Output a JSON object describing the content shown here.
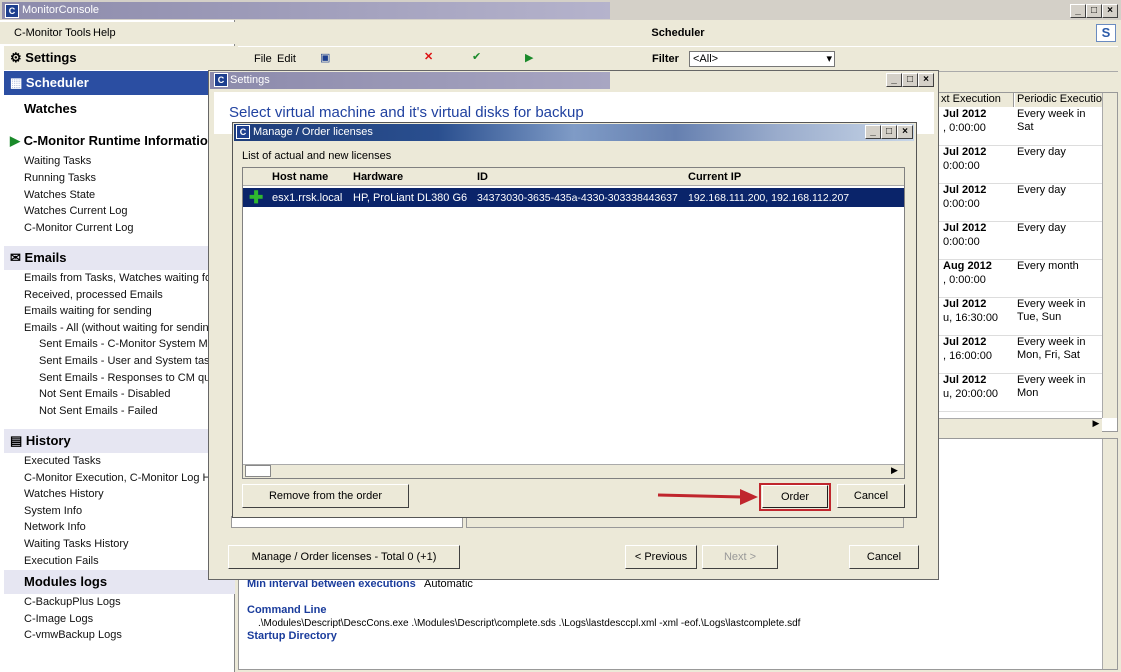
{
  "window": {
    "title": "MonitorConsole",
    "logo": "C"
  },
  "menu": {
    "tools": "C-Monitor Tools",
    "help": "Help"
  },
  "sidebar": {
    "settings": "Settings",
    "scheduler": "Scheduler",
    "watches": "Watches",
    "runtime": "C-Monitor Runtime Informatio",
    "runtime_items": [
      "Waiting Tasks",
      "Running Tasks",
      "Watches State",
      "Watches Current Log",
      "C-Monitor Current Log"
    ],
    "emails": "Emails",
    "email_items": [
      "Emails from Tasks, Watches waiting for se",
      "Received, processed Emails",
      "Emails waiting for sending",
      "Emails - All (without waiting for sending)"
    ],
    "email_sub_items": [
      "Sent Emails - C-Monitor System Messa",
      "Sent Emails - User and System tasks R",
      "Sent Emails - Responses to CM querie",
      "Not Sent Emails - Disabled",
      "Not Sent Emails - Failed"
    ],
    "history": "History",
    "history_items": [
      "Executed Tasks",
      "C-Monitor Execution, C-Monitor Log Histor",
      "Watches History",
      "System Info",
      "Network Info",
      "Waiting Tasks History",
      "Execution Fails"
    ],
    "modules": "Modules logs",
    "module_items": [
      "C-BackupPlus Logs",
      "C-Image Logs",
      "C-vmwBackup Logs"
    ]
  },
  "scheduler": {
    "title": "Scheduler",
    "toolbar": {
      "file": "File",
      "edit": "Edit",
      "filter": "Filter",
      "filter_value": "<All>"
    },
    "columns": {
      "next": "xt Execution",
      "periodic": "Periodic Execution"
    },
    "rows": [
      {
        "date": "Jul 2012",
        "time": ", 0:00:00",
        "period": "Every week in Sat"
      },
      {
        "date": "Jul 2012",
        "time": "0:00:00",
        "period": "Every day"
      },
      {
        "date": "Jul 2012",
        "time": "0:00:00",
        "period": "Every day"
      },
      {
        "date": "Jul 2012",
        "time": "0:00:00",
        "period": "Every day"
      },
      {
        "date": "Aug 2012",
        "time": ", 0:00:00",
        "period": "Every month"
      },
      {
        "date": "Jul 2012",
        "time": "u, 16:30:00",
        "period": "Every week in Tue, Sun"
      },
      {
        "date": "Jul 2012",
        "time": ", 16:00:00",
        "period": "Every week in Mon, Fri, Sat"
      },
      {
        "date": "Jul 2012",
        "time": "u, 20:00:00",
        "period": "Every week in Mon"
      }
    ],
    "details": {
      "min_interval_label": "Min interval between executions",
      "min_interval_value": "Automatic",
      "command_line_label": "Command Line",
      "command_line_value": ".\\Modules\\Descript\\DescCons.exe .\\Modules\\Descript\\complete.sds .\\Logs\\lastdesccpl.xml -xml -eof.\\Logs\\lastcomplete.sdf",
      "startup_label": "Startup Directory"
    }
  },
  "settings_dialog": {
    "title": "Settings",
    "heading": "Select virtual machine and it's virtual disks for backup",
    "licenses_button": "Manage / Order licenses - Total 0 (+1)",
    "previous": "< Previous",
    "next": "Next >",
    "cancel": "Cancel"
  },
  "licenses_dialog": {
    "title": "Manage / Order licenses",
    "list_label": "List of actual and new licenses",
    "columns": {
      "host": "Host name",
      "hardware": "Hardware",
      "id": "ID",
      "ip": "Current IP"
    },
    "rows": [
      {
        "host": "esx1.rrsk.local",
        "hardware": "HP, ProLiant DL380 G6",
        "id": "34373030-3635-435a-4330-303338443637",
        "ip": "192.168.111.200, 192.168.112.207"
      }
    ],
    "remove_button": "Remove from the order",
    "order_button": "Order",
    "cancel_button": "Cancel"
  },
  "colors": {
    "selection": "#0a246a",
    "highlight_box": "#c0262d",
    "arrow": "#c0262d",
    "accent_blue": "#2b4ea2"
  }
}
